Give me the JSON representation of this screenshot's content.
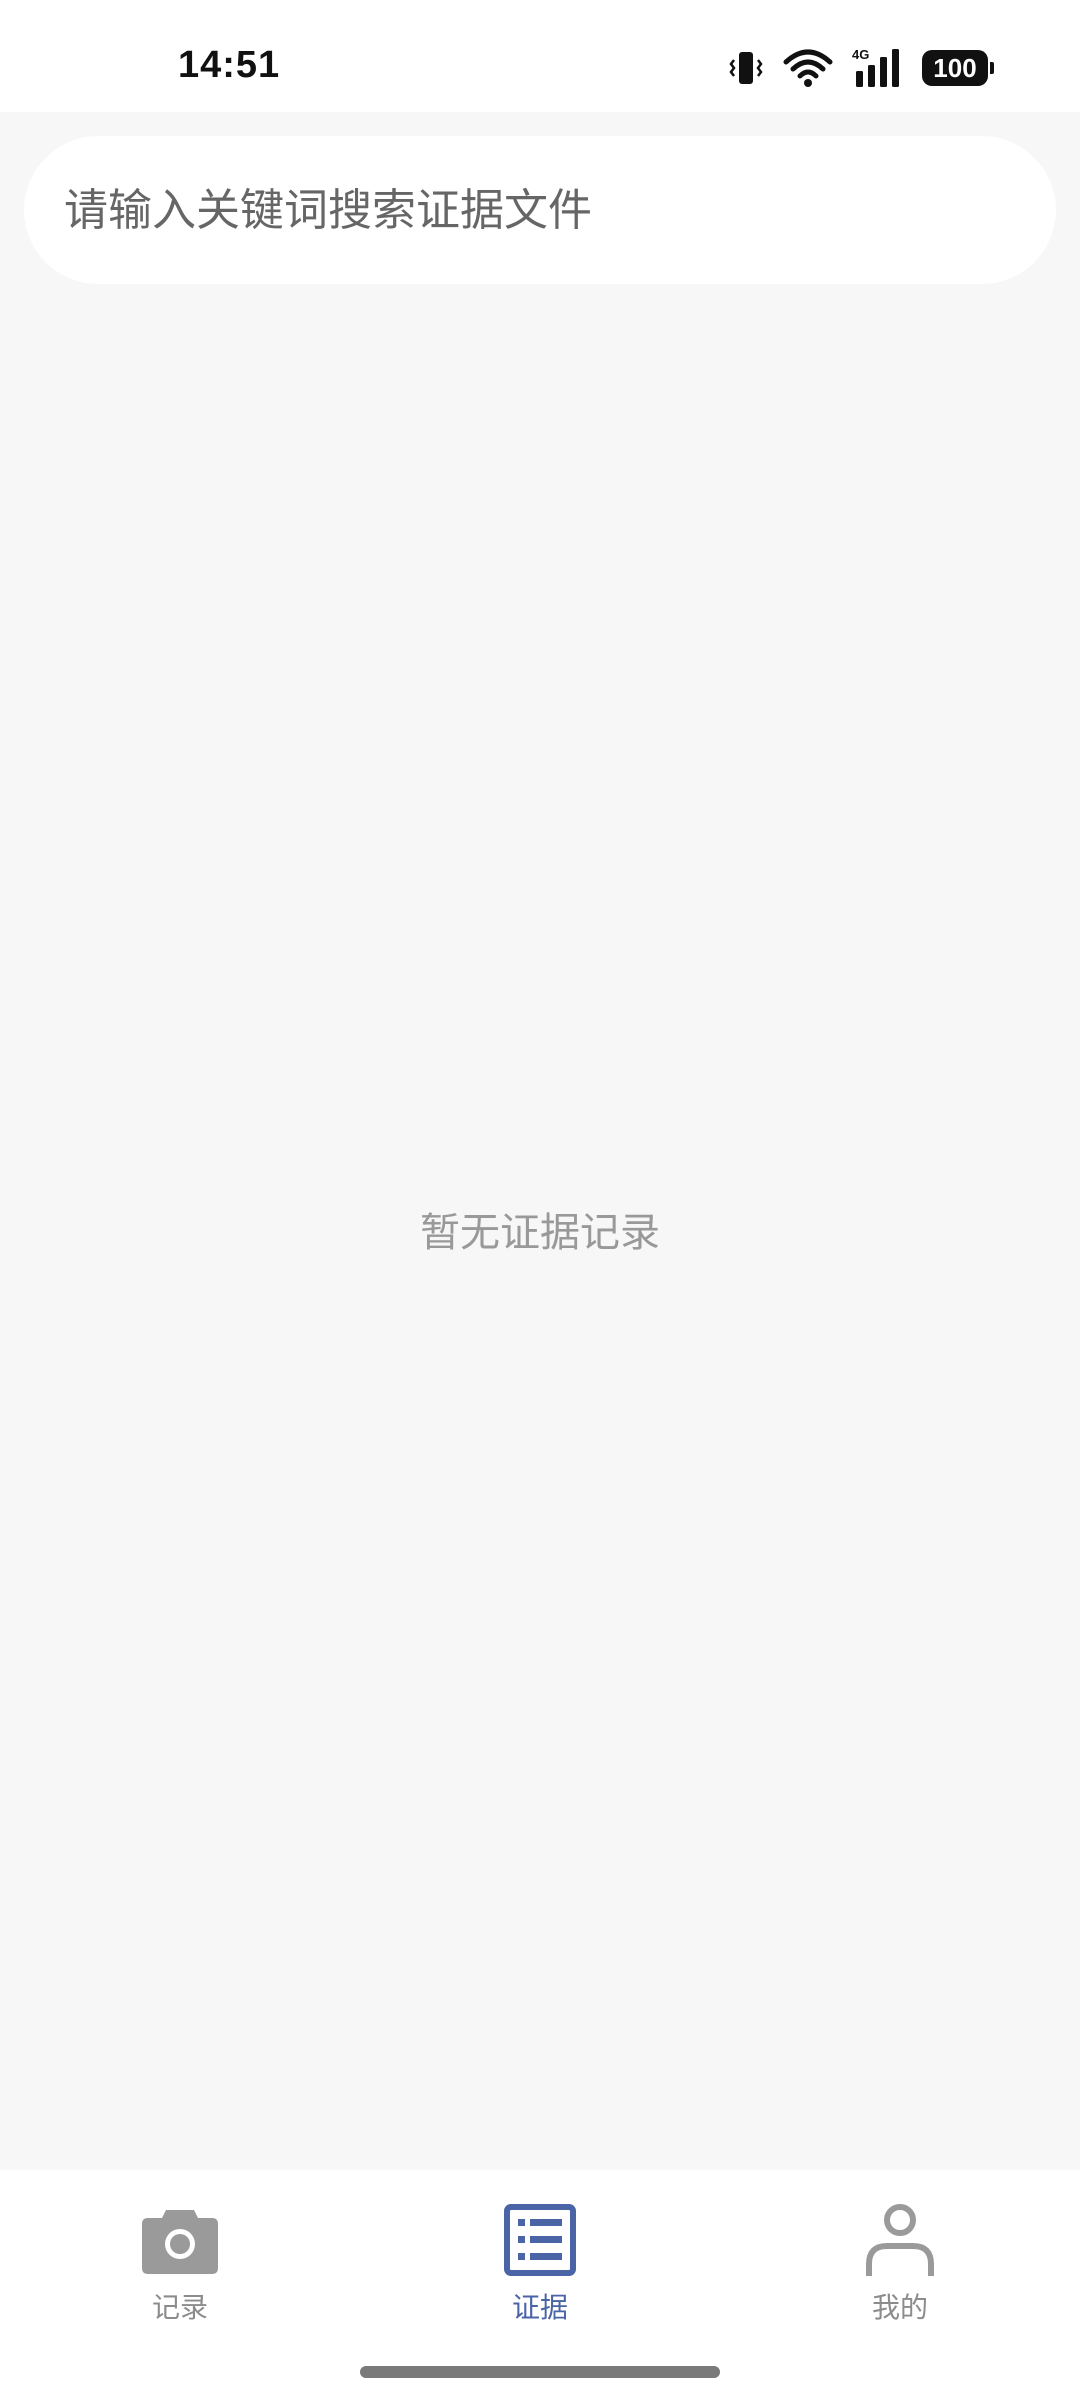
{
  "status_bar": {
    "time": "14:51",
    "network": "4G",
    "battery": "100"
  },
  "search": {
    "placeholder": "请输入关键词搜索证据文件"
  },
  "main": {
    "empty_text": "暂无证据记录"
  },
  "bottom_nav": {
    "items": [
      {
        "label": "记录",
        "icon": "camera-icon"
      },
      {
        "label": "证据",
        "icon": "list-icon",
        "active": true
      },
      {
        "label": "我的",
        "icon": "person-icon"
      }
    ]
  },
  "colors": {
    "accent": "#4a64a6",
    "inactive": "#8c8c8c",
    "background": "#f7f7f7"
  }
}
